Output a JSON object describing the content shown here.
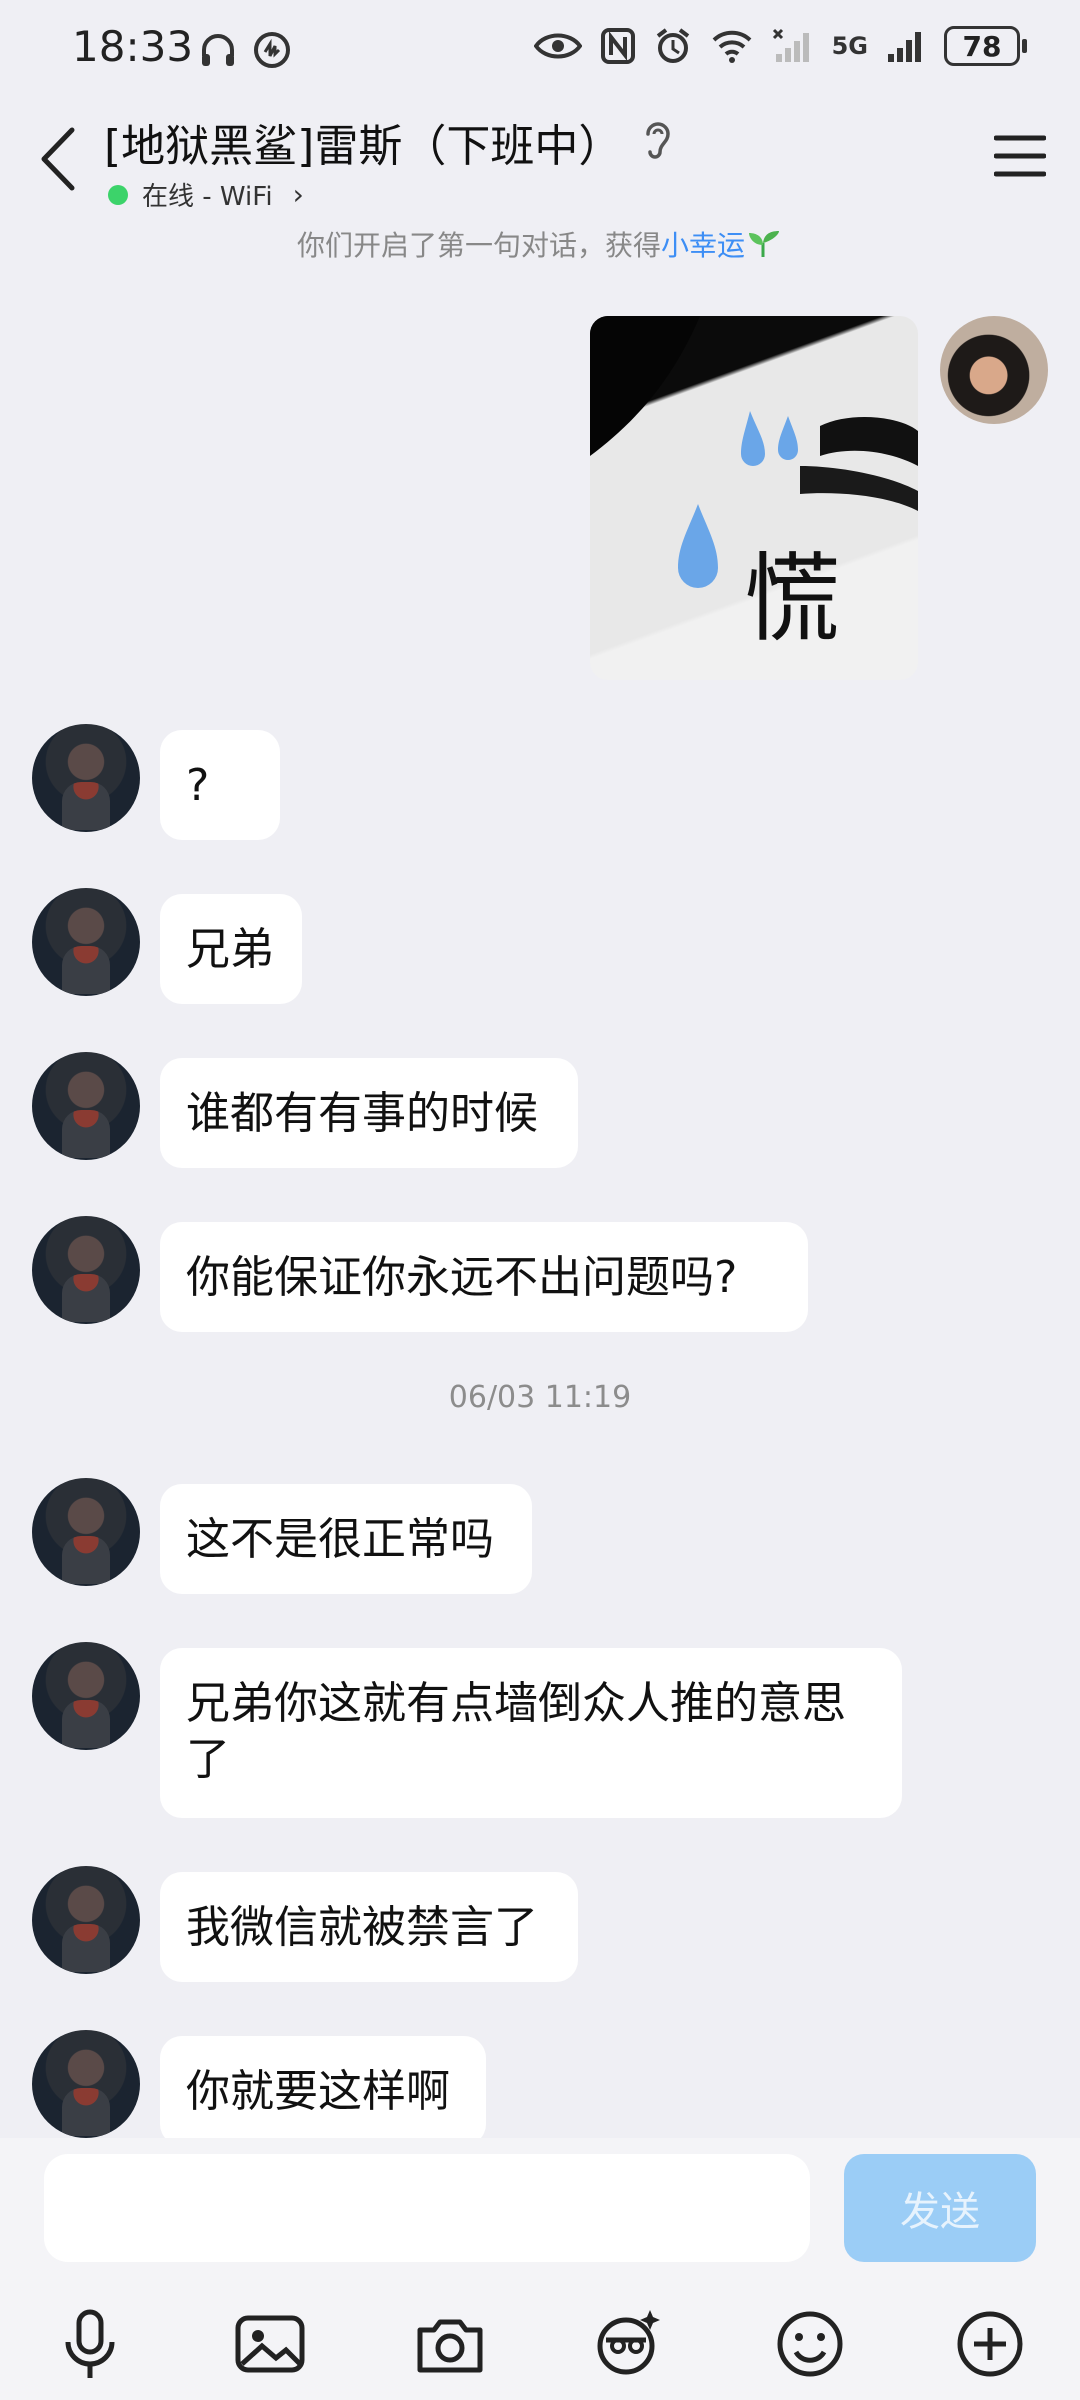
{
  "status_bar": {
    "time": "18:33",
    "network": "5G",
    "battery": "78"
  },
  "header": {
    "title": "[地狱黑鲨]雷斯（下班中）",
    "online_status": "在线 - WiFi"
  },
  "system_note": {
    "prefix": "你们开启了第一句对话，获得",
    "highlight": "小幸运"
  },
  "sticker": {
    "text": "慌"
  },
  "messages": [
    {
      "text": "?"
    },
    {
      "text": "兄弟"
    },
    {
      "text": "谁都有有事的时候"
    },
    {
      "text": "你能保证你永远不出问题吗?"
    },
    {
      "text": "这不是很正常吗"
    },
    {
      "text": "兄弟你这就有点墙倒众人推的意思了"
    },
    {
      "text": "我微信就被禁言了"
    },
    {
      "text": "你就要这样啊"
    }
  ],
  "timestamp": "06/03 11:19",
  "composer": {
    "send_label": "发送"
  },
  "colors": {
    "background": "#efeff4",
    "bubble": "#ffffff",
    "accent": "#3d8ef5",
    "send_disabled": "#9bcdf6",
    "online": "#3cd36a"
  }
}
